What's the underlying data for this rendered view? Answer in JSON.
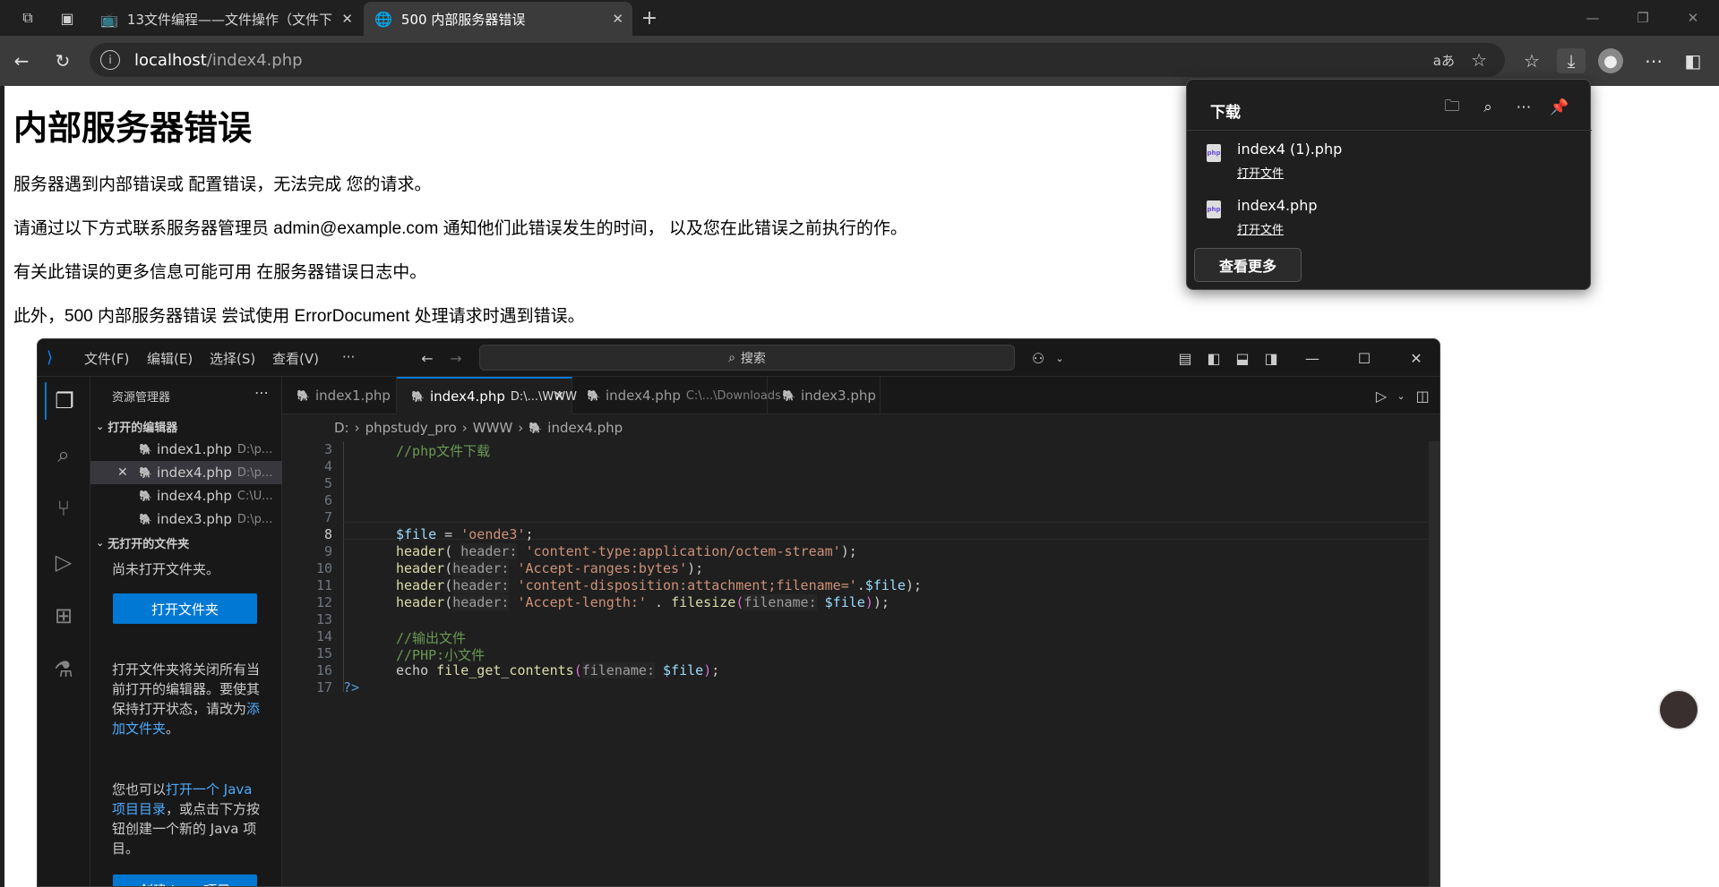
{
  "browser": {
    "tabs": [
      {
        "title": "13文件编程——文件操作（文件下"
      },
      {
        "title": "500 内部服务器错误"
      }
    ],
    "url_host": "localhost",
    "url_path": "/index4.php"
  },
  "page": {
    "title": "内部服务器错误",
    "p1": "服务器遇到内部错误或 配置错误，无法完成 您的请求。",
    "p2": "请通过以下方式联系服务器管理员 admin@example.com 通知他们此错误发生的时间， 以及您在此错误之前执行的作。",
    "p3": "有关此错误的更多信息可能可用 在服务器错误日志中。",
    "p4": "此外，500 内部服务器错误 尝试使用 ErrorDocument 处理请求时遇到错误。"
  },
  "downloads": {
    "heading": "下载",
    "items": [
      {
        "name": "index4 (1).php",
        "action": "打开文件"
      },
      {
        "name": "index4.php",
        "action": "打开文件"
      }
    ],
    "more": "查看更多"
  },
  "vscode": {
    "menu": [
      "文件(F)",
      "编辑(E)",
      "选择(S)",
      "查看(V)",
      "···"
    ],
    "search": "搜索",
    "explorer_title": "资源管理器",
    "open_editors": "打开的编辑器",
    "open_files": [
      {
        "name": "index1.php",
        "path": "D:\\p..."
      },
      {
        "name": "index4.php",
        "path": "D:\\p..."
      },
      {
        "name": "index4.php",
        "path": "C:\\U..."
      },
      {
        "name": "index3.php",
        "path": "D:\\p..."
      }
    ],
    "no_folder": "无打开的文件夹",
    "no_folder_msg": "尚未打开文件夹。",
    "open_folder_btn": "打开文件夹",
    "info1": "打开文件夹将关闭所有当前打开的编辑器。要使其保持打开状态，请改为",
    "info1_link": "添加文件夹",
    "info1_end": "。",
    "info2_pre": "您也可以",
    "info2_link": "打开一个 Java 项目目录",
    "info2_post": "，或点击下方按钮创建一个新的 Java 项目。",
    "create_java_btn": "创建 Java 项目",
    "tabs": [
      {
        "name": "index1.php",
        "path": ""
      },
      {
        "name": "index4.php",
        "path": "D:\\...\\WWW"
      },
      {
        "name": "index4.php",
        "path": "C:\\...\\Downloads"
      },
      {
        "name": "index3.php",
        "path": ""
      }
    ],
    "breadcrumbs": [
      "D:",
      "phpstudy_pro",
      "WWW",
      "index4.php"
    ],
    "line_numbers": [
      "3",
      "4",
      "5",
      "6",
      "7",
      "8",
      "9",
      "10",
      "11",
      "12",
      "13",
      "14",
      "15",
      "16",
      "17"
    ],
    "code": {
      "l3": "//php文件下载",
      "l8_var": "$file",
      "l8_op": " = ",
      "l8_str": "'oende3'",
      "l8_end": ";",
      "fn_header": "header",
      "hint_header": "header:",
      "l9_str": "'content-type:application/octem-stream'",
      "l10_str": "'Accept-ranges:bytes'",
      "l11_str": "'content-disposition:attachment;filename='",
      "l11_cat": ".",
      "l12_str": "'Accept-length:'",
      "l12_cat": " . ",
      "fn_filesize": "filesize",
      "hint_filename": "filename:",
      "l14": "//输出文件",
      "l15": "//PHP:小文件",
      "l16_echo": "echo ",
      "fn_fgc": "file_get_contents",
      "close_tag": "?>"
    }
  }
}
